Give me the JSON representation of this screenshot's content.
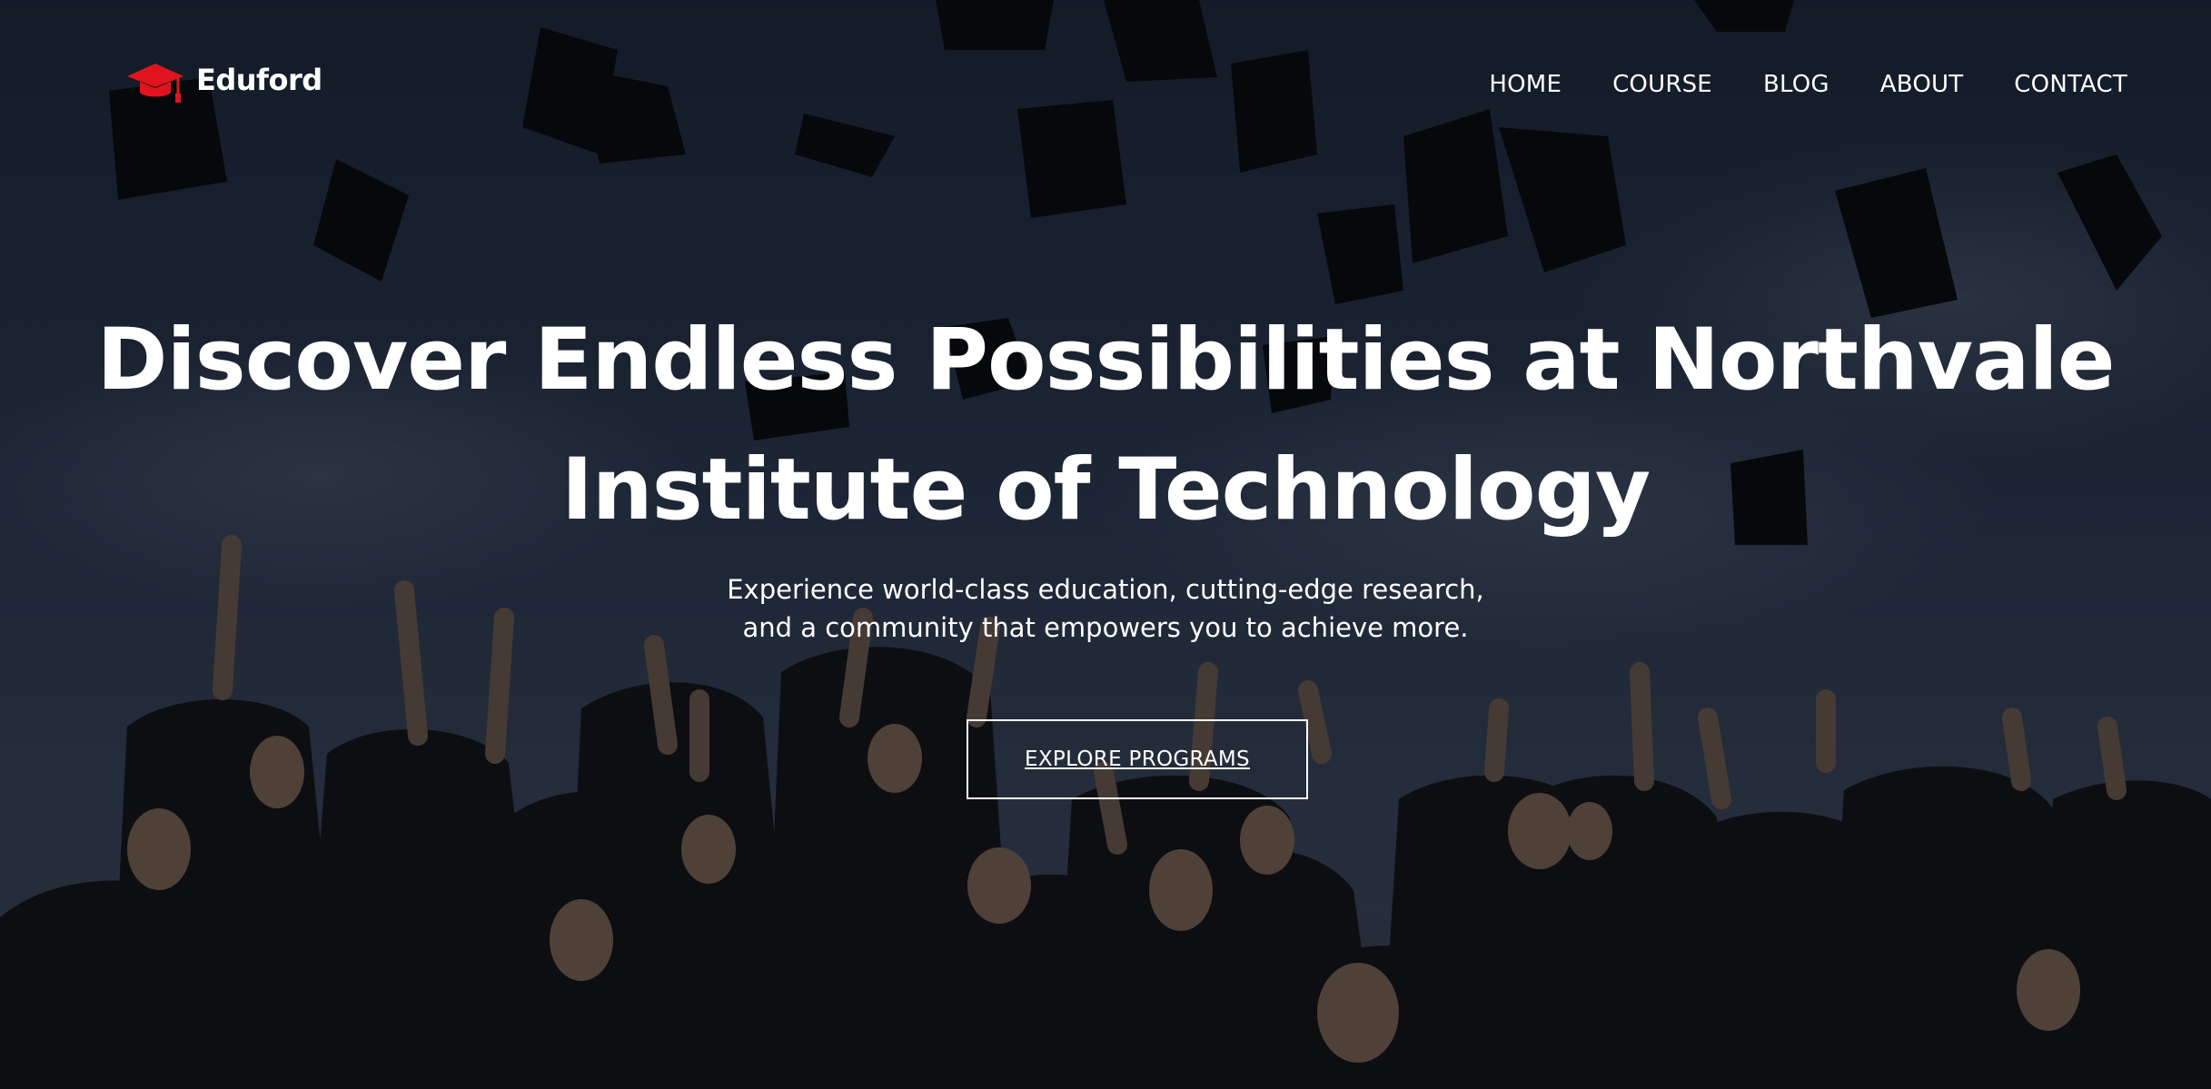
{
  "brand": {
    "name": "Eduford",
    "icon": "graduation-cap-icon",
    "accent_color": "#e0141e"
  },
  "nav": {
    "items": [
      {
        "label": "HOME"
      },
      {
        "label": "COURSE"
      },
      {
        "label": "BLOG"
      },
      {
        "label": "ABOUT"
      },
      {
        "label": "CONTACT"
      }
    ]
  },
  "hero": {
    "headline_line1": "Discover Endless Possibilities at Northvale",
    "headline_line2": "Institute of Technology",
    "subtitle_line1": "Experience world-class education, cutting-edge research,",
    "subtitle_line2": "and a community that empowers you to achieve more.",
    "cta_label": "EXPLORE PROGRAMS",
    "background": "graduates-throwing-caps-photo"
  }
}
